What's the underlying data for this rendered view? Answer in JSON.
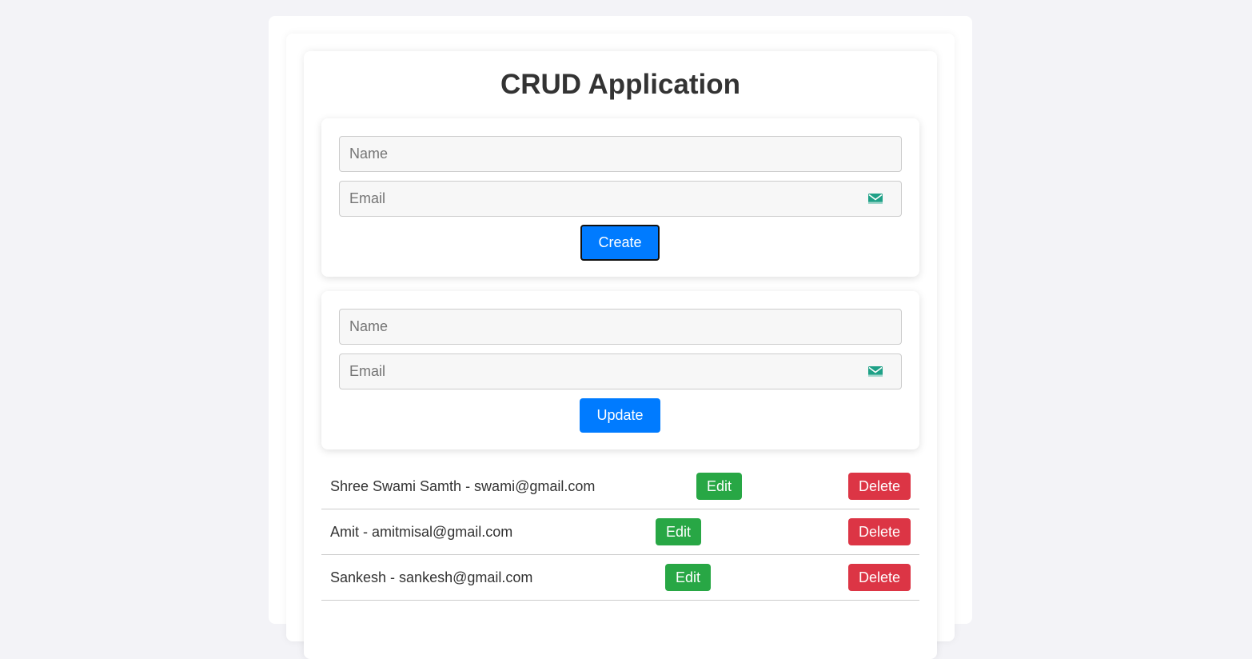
{
  "page": {
    "title": "CRUD Application"
  },
  "create_form": {
    "name_placeholder": "Name",
    "name_value": "",
    "email_placeholder": "Email",
    "email_value": "",
    "submit_label": "Create"
  },
  "update_form": {
    "name_placeholder": "Name",
    "name_value": "",
    "email_placeholder": "Email",
    "email_value": "",
    "submit_label": "Update"
  },
  "users": [
    {
      "text": "Shree Swami Samth - swami@gmail.com",
      "edit_label": "Edit",
      "delete_label": "Delete"
    },
    {
      "text": "Amit - amitmisal@gmail.com",
      "edit_label": "Edit",
      "delete_label": "Delete"
    },
    {
      "text": "Sankesh - sankesh@gmail.com",
      "edit_label": "Edit",
      "delete_label": "Delete"
    }
  ],
  "icons": {
    "email_field_icon": "envelope-icon"
  },
  "colors": {
    "primary": "#007bff",
    "edit": "#28a745",
    "delete": "#dc3545",
    "background": "#f3f3f7"
  }
}
